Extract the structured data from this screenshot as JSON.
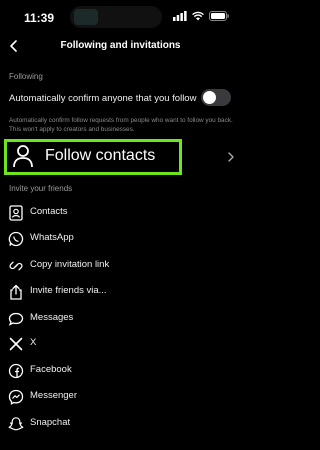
{
  "status_bar": {
    "time": "11:39"
  },
  "header": {
    "title": "Following and invitations"
  },
  "following": {
    "section_label": "Following",
    "auto_confirm_label": "Automatically confirm anyone that you follow",
    "auto_confirm_enabled": false,
    "helper_text": "Automatically confirm follow requests from people who want to follow you back. This won't apply to creators and businesses."
  },
  "follow_contacts": {
    "label": "Follow contacts",
    "highlight_color": "#6ee61e"
  },
  "invite": {
    "section_label": "Invite your friends",
    "items": [
      {
        "label": "Contacts",
        "icon": "contacts-icon"
      },
      {
        "label": "WhatsApp",
        "icon": "whatsapp-icon"
      },
      {
        "label": "Copy invitation link",
        "icon": "link-icon"
      },
      {
        "label": "Invite friends via...",
        "icon": "share-icon"
      },
      {
        "label": "Messages",
        "icon": "messages-icon"
      },
      {
        "label": "X",
        "icon": "x-icon"
      },
      {
        "label": "Facebook",
        "icon": "facebook-icon"
      },
      {
        "label": "Messenger",
        "icon": "messenger-icon"
      },
      {
        "label": "Snapchat",
        "icon": "snapchat-icon"
      }
    ]
  }
}
